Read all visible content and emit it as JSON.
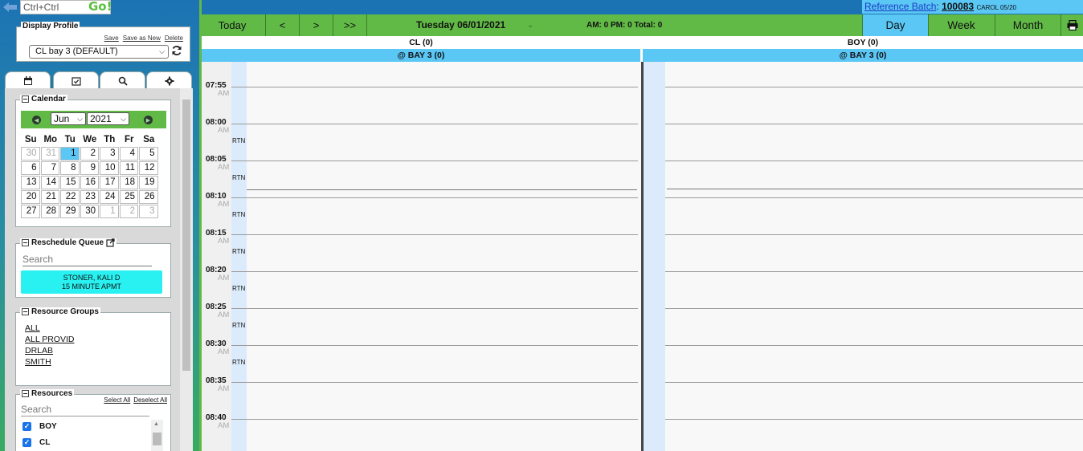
{
  "quick": {
    "placeholder": "Ctrl+Ctrl",
    "go": "Go!"
  },
  "profile": {
    "legend": "Display Profile",
    "links": [
      "Save",
      "Save as New",
      "Delete"
    ],
    "selected": "CL bay 3 (DEFAULT)"
  },
  "tabs": [
    "calendar-icon",
    "checklist-icon",
    "search-icon",
    "gear-icon"
  ],
  "calendar": {
    "legend": "Calendar",
    "month": "Jun",
    "year": "2021",
    "dow": [
      "Su",
      "Mo",
      "Tu",
      "We",
      "Th",
      "Fr",
      "Sa"
    ],
    "weeks": [
      [
        "30",
        "31",
        "1",
        "2",
        "3",
        "4",
        "5"
      ],
      [
        "6",
        "7",
        "8",
        "9",
        "10",
        "11",
        "12"
      ],
      [
        "13",
        "14",
        "15",
        "16",
        "17",
        "18",
        "19"
      ],
      [
        "20",
        "21",
        "22",
        "23",
        "24",
        "25",
        "26"
      ],
      [
        "27",
        "28",
        "29",
        "30",
        "1",
        "2",
        "3"
      ]
    ],
    "selected": "1"
  },
  "reschedule": {
    "legend": "Reschedule Queue",
    "search_placeholder": "Search",
    "item_name": "STONER, KALI D",
    "item_desc": "15 MINUTE APMT"
  },
  "resource_groups": {
    "legend": "Resource Groups",
    "items": [
      "ALL",
      "ALL PROVID",
      "DRLAB",
      "SMITH"
    ]
  },
  "resources": {
    "legend": "Resources",
    "select_all": "Select All",
    "deselect_all": "Deselect All",
    "search_placeholder": "Search",
    "items": [
      {
        "name": "BOY",
        "checked": true
      },
      {
        "name": "CL",
        "checked": true
      }
    ]
  },
  "reference": {
    "label": "Reference Batch",
    "number": "100083",
    "user": "CAROL 05/20"
  },
  "toolbar": {
    "today": "Today",
    "prev": "<",
    "next": ">",
    "fast": ">>",
    "date": "Tuesday 06/01/2021",
    "counts": "AM: 0 PM: 0 Total: 0",
    "views": [
      "Day",
      "Week",
      "Month"
    ],
    "active_view": "Day"
  },
  "columns": [
    {
      "name": "CL (0)",
      "location": "@ BAY 3 (0)"
    },
    {
      "name": "BOY (0)",
      "location": "@ BAY 3 (0)"
    }
  ],
  "times": [
    "07:55",
    "08:00",
    "08:05",
    "08:10",
    "08:15",
    "08:20",
    "08:25",
    "08:30",
    "08:35",
    "08:40"
  ],
  "am": "AM",
  "rtn_label": "RTN",
  "colors": {
    "green": "#61b946",
    "blue": "#5bc7f5",
    "navy": "#1c73b4",
    "queue": "#29f1f1"
  }
}
